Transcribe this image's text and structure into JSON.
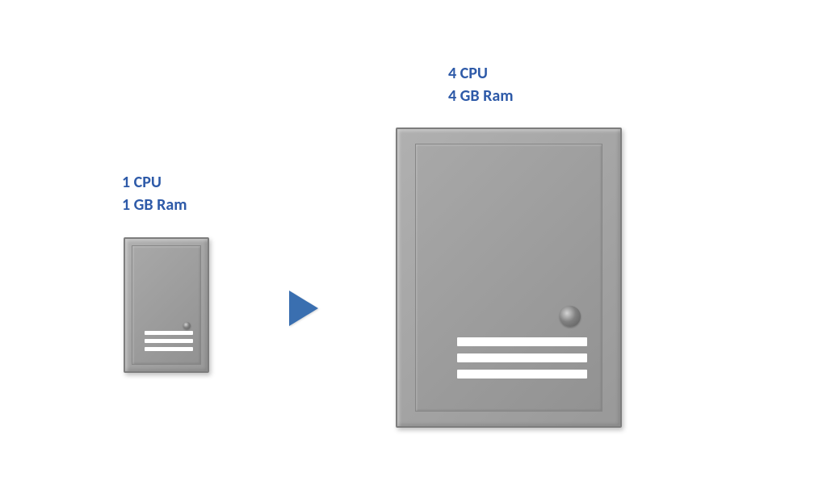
{
  "diagram": {
    "small_server": {
      "cpu_line": "1 CPU",
      "ram_line": "1 GB Ram"
    },
    "large_server": {
      "cpu_line": "4 CPU",
      "ram_line": "4 GB Ram"
    }
  }
}
